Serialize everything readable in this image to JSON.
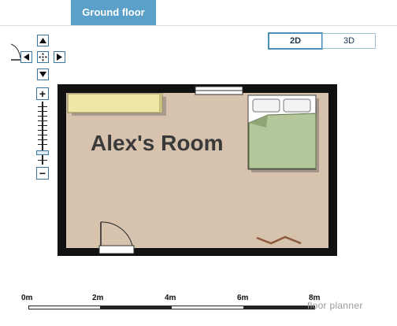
{
  "tabs": {
    "active": "Ground floor"
  },
  "view_toggle": {
    "option_2d": "2D",
    "option_3d": "3D"
  },
  "controls": {
    "zoom_in": "+",
    "zoom_out": "−"
  },
  "room": {
    "label": "Alex's Room"
  },
  "scale": {
    "labels": [
      "0m",
      "2m",
      "4m",
      "6m",
      "8m"
    ]
  },
  "brand": {
    "text": "floor planner"
  },
  "colors": {
    "tab_active": "#5aa0c8",
    "floor": "#d6c2ad",
    "wall": "#111111",
    "bed_cover": "#b4c79a",
    "desk": "#efe7a6"
  }
}
